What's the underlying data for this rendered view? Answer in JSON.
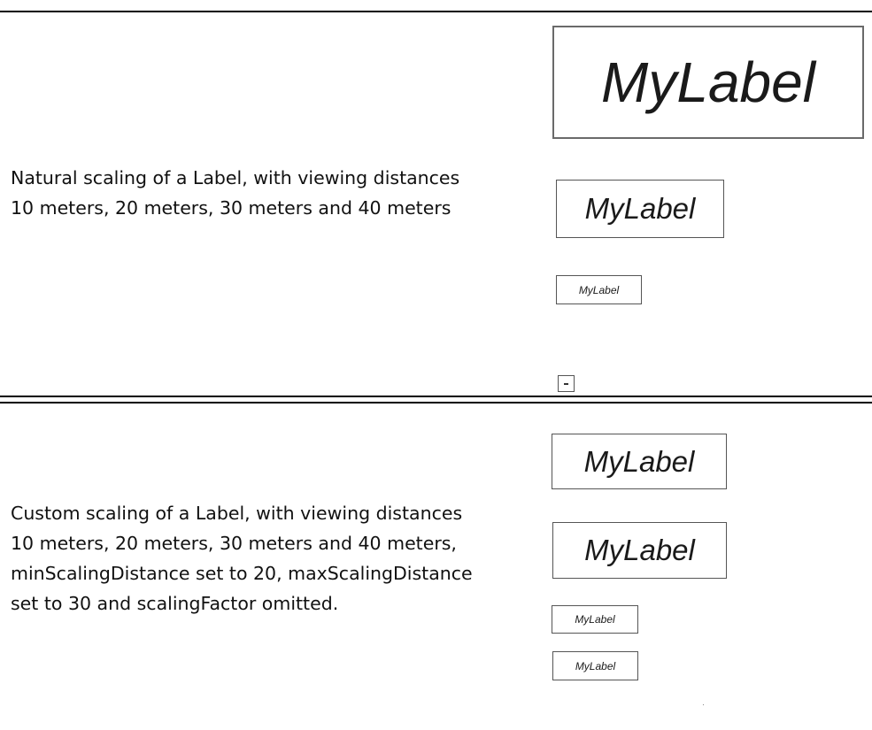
{
  "section_natural": {
    "description": "Natural scaling of a Label, with viewing distances\n10 meters, 20 meters, 30 meters and 40 meters",
    "labels": [
      "MyLabel",
      "MyLabel",
      "MyLabel",
      ""
    ]
  },
  "section_custom": {
    "description": "Custom scaling of a Label, with viewing distances\n10 meters, 20 meters, 30 meters and 40 meters,\nminScalingDistance set to 20, maxScalingDistance\nset to 30 and scalingFactor omitted.",
    "labels": [
      "MyLabel",
      "MyLabel",
      "MyLabel",
      "MyLabel"
    ]
  }
}
